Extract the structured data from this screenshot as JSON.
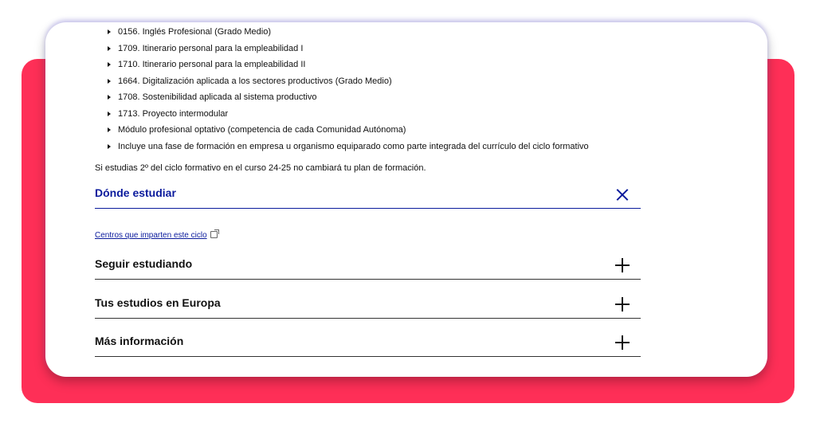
{
  "modules": [
    "0156. Inglés Profesional (Grado Medio)",
    "1709. Itinerario personal para la empleabilidad I",
    "1710. Itinerario personal para la empleabilidad II",
    "1664. Digitalización aplicada a los sectores productivos (Grado Medio)",
    "1708. Sostenibilidad aplicada al sistema productivo",
    "1713. Proyecto intermodular",
    "Módulo profesional optativo (competencia de cada Comunidad Autónoma)",
    "Incluye una fase de formación en empresa u organismo equiparado como parte integrada del currículo del ciclo formativo"
  ],
  "note": "Si estudias 2º del ciclo formativo en el curso 24-25 no cambiará tu plan de formación.",
  "where_to_study": {
    "title": "Dónde estudiar",
    "link_text": "Centros que imparten este ciclo"
  },
  "sections": [
    {
      "title": "Seguir estudiando"
    },
    {
      "title": "Tus estudios en Europa"
    },
    {
      "title": "Más información"
    }
  ],
  "colors": {
    "backdrop": "#fe2f57",
    "accent": "#0a1a9c",
    "side_tab": "#2a6fd0"
  },
  "icons": {
    "bullet": "triangle-right-icon",
    "close": "close-icon",
    "expand": "plus-icon",
    "external": "external-link-icon",
    "side_tab": "chevron-right-icon"
  }
}
